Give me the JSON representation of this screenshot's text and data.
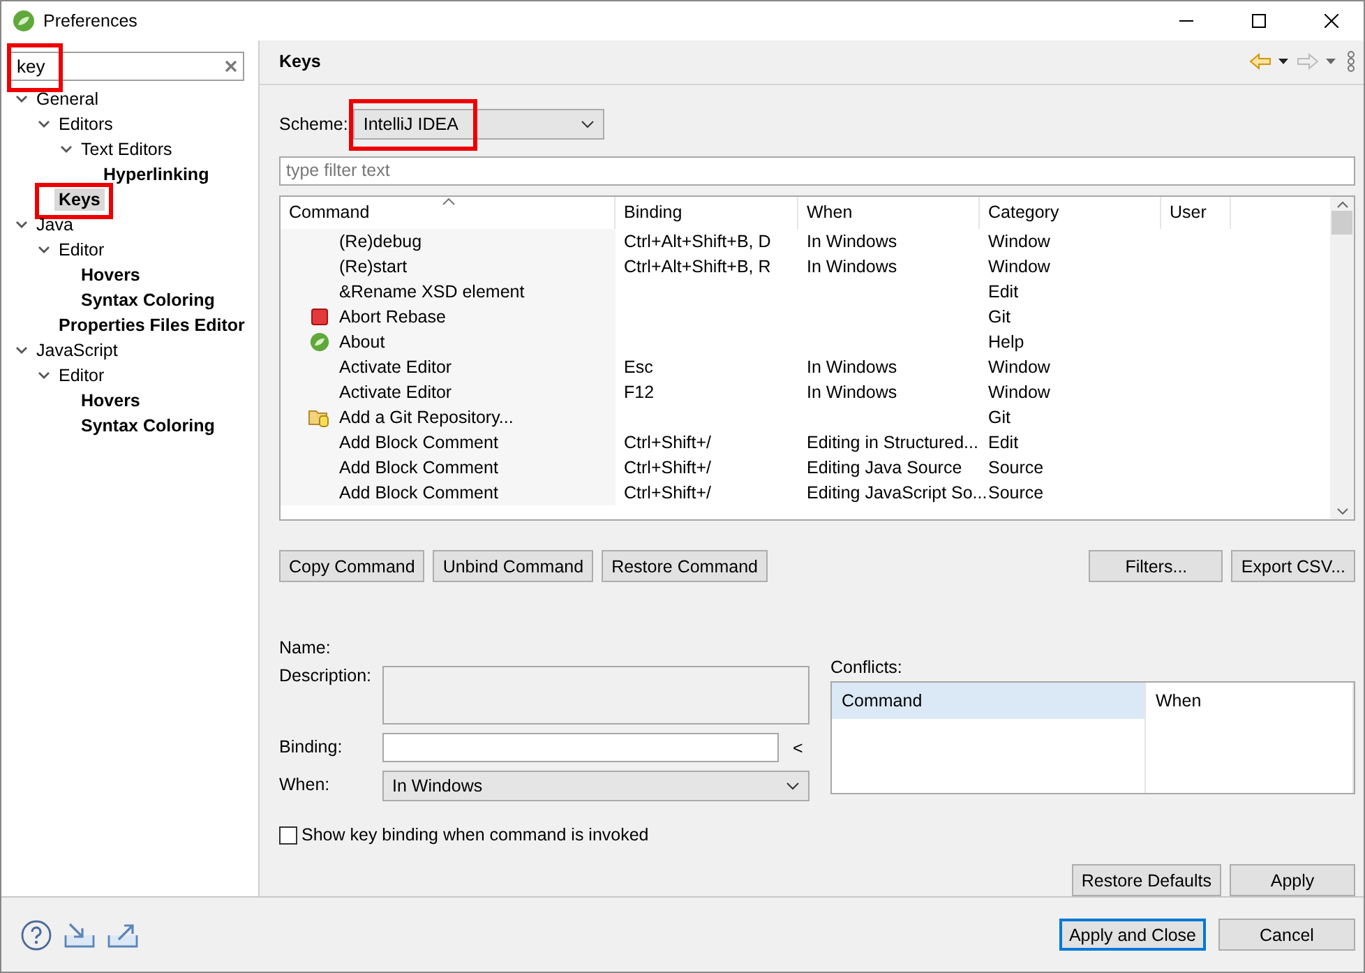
{
  "window": {
    "title": "Preferences"
  },
  "filter": {
    "value": "key",
    "highlighted": true
  },
  "tree": [
    {
      "label": "General",
      "expanded": true,
      "matched": false,
      "selected": false,
      "highlighted": false,
      "children": [
        {
          "label": "Editors",
          "expanded": true,
          "matched": false,
          "selected": false,
          "highlighted": false,
          "children": [
            {
              "label": "Text Editors",
              "expanded": true,
              "matched": false,
              "selected": false,
              "highlighted": false,
              "children": [
                {
                  "label": "Hyperlinking",
                  "matched": true,
                  "selected": false,
                  "highlighted": false
                }
              ]
            }
          ]
        },
        {
          "label": "Keys",
          "matched": true,
          "selected": true,
          "highlighted": true
        }
      ]
    },
    {
      "label": "Java",
      "expanded": true,
      "matched": false,
      "selected": false,
      "highlighted": false,
      "children": [
        {
          "label": "Editor",
          "expanded": true,
          "matched": false,
          "selected": false,
          "highlighted": false,
          "children": [
            {
              "label": "Hovers",
              "matched": true,
              "selected": false,
              "highlighted": false
            },
            {
              "label": "Syntax Coloring",
              "matched": true,
              "selected": false,
              "highlighted": false
            }
          ]
        },
        {
          "label": "Properties Files Editor",
          "matched": true,
          "selected": false,
          "highlighted": false
        }
      ]
    },
    {
      "label": "JavaScript",
      "expanded": true,
      "matched": false,
      "selected": false,
      "highlighted": false,
      "children": [
        {
          "label": "Editor",
          "expanded": true,
          "matched": false,
          "selected": false,
          "highlighted": false,
          "children": [
            {
              "label": "Hovers",
              "matched": true,
              "selected": false,
              "highlighted": false
            },
            {
              "label": "Syntax Coloring",
              "matched": true,
              "selected": false,
              "highlighted": false
            }
          ]
        }
      ]
    }
  ],
  "page": {
    "title": "Keys"
  },
  "scheme": {
    "label": "Scheme:",
    "value": "IntelliJ IDEA",
    "highlighted": true
  },
  "table_filter": {
    "placeholder": "type filter text"
  },
  "table": {
    "columns": [
      "Command",
      "Binding",
      "When",
      "Category",
      "User"
    ],
    "rows": [
      {
        "kind": "plain",
        "cells": [
          "(Re)debug",
          "Ctrl+Alt+Shift+B, D",
          "In Windows",
          "Window",
          ""
        ]
      },
      {
        "kind": "plain",
        "cells": [
          "(Re)start",
          "Ctrl+Alt+Shift+B, R",
          "In Windows",
          "Window",
          ""
        ]
      },
      {
        "kind": "plain",
        "cells": [
          "&Rename XSD element",
          "",
          "",
          "Edit",
          ""
        ]
      },
      {
        "kind": "stop",
        "cells": [
          "Abort Rebase",
          "",
          "",
          "Git",
          ""
        ]
      },
      {
        "kind": "leaf",
        "cells": [
          "About",
          "",
          "",
          "Help",
          ""
        ]
      },
      {
        "kind": "plain",
        "cells": [
          "Activate Editor",
          "Esc",
          "In Windows",
          "Window",
          ""
        ]
      },
      {
        "kind": "plain",
        "cells": [
          "Activate Editor",
          "F12",
          "In Windows",
          "Window",
          ""
        ]
      },
      {
        "kind": "repository",
        "cells": [
          "Add a Git Repository...",
          "",
          "",
          "Git",
          ""
        ]
      },
      {
        "kind": "plain",
        "cells": [
          "Add Block Comment",
          "Ctrl+Shift+/",
          "Editing in Structured...",
          "Edit",
          ""
        ]
      },
      {
        "kind": "plain",
        "cells": [
          "Add Block Comment",
          "Ctrl+Shift+/",
          "Editing Java Source",
          "Source",
          ""
        ]
      },
      {
        "kind": "plain",
        "cells": [
          "Add Block Comment",
          "Ctrl+Shift+/",
          "Editing JavaScript So...",
          "Source",
          ""
        ]
      }
    ]
  },
  "table_buttons_left": [
    "Copy Command",
    "Unbind Command",
    "Restore Command"
  ],
  "table_buttons_right": [
    "Filters...",
    "Export CSV..."
  ],
  "details": {
    "name_label": "Name:",
    "description_label": "Description:",
    "binding_label": "Binding:",
    "binding_button": "<",
    "when_label": "When:",
    "when_value": "In Windows"
  },
  "conflicts": {
    "label": "Conflicts:",
    "columns": [
      {
        "label": "Command",
        "selected": true
      },
      {
        "label": "When",
        "selected": false
      }
    ]
  },
  "show_binding": {
    "label": "Show key binding when command is invoked",
    "checked": false
  },
  "page_buttons": [
    "Restore Defaults",
    "Apply"
  ],
  "footer_buttons": [
    {
      "label": "Apply and Close",
      "default": true
    },
    {
      "label": "Cancel",
      "default": false
    }
  ]
}
